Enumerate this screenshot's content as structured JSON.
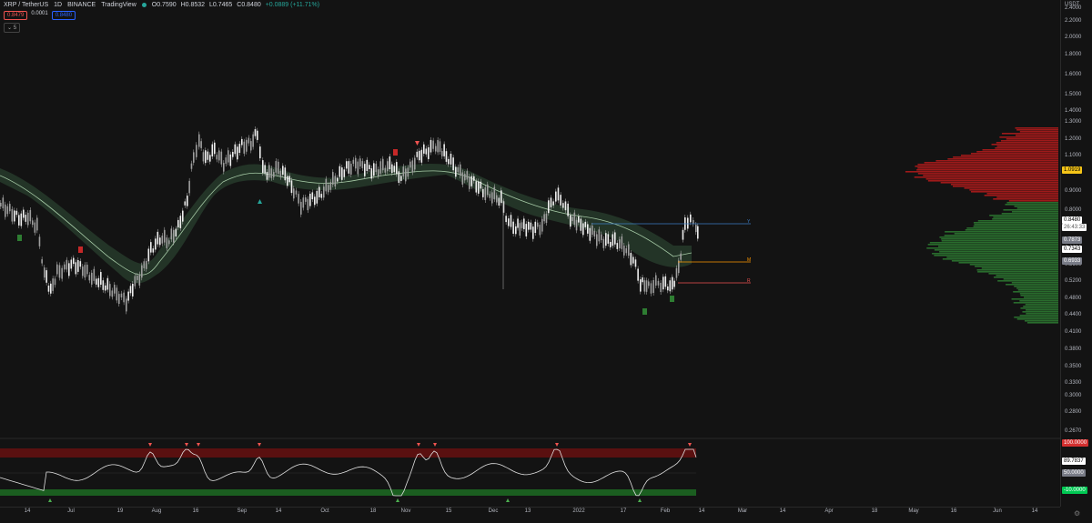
{
  "header": {
    "symbol": "XRP / TetherUS",
    "interval": "1D",
    "exchange": "BINANCE",
    "source": "TradingView",
    "ohlc": {
      "o": "O0.7590",
      "h": "H0.8532",
      "l": "L0.7465",
      "c": "C0.8480",
      "change": "+0.0889 (+11.71%)"
    }
  },
  "indicator_row": {
    "bid": "0.8479",
    "spread": "0.0001",
    "ask": "0.8480"
  },
  "collapse_label": "5",
  "price_scale": {
    "unit": "USDT",
    "ticks": [
      "2.4000",
      "2.2000",
      "2.0000",
      "1.8000",
      "1.6000",
      "1.5000",
      "1.4000",
      "1.3000",
      "1.2000",
      "1.1000",
      "1.0000",
      "0.9000",
      "0.8000",
      "0.7000",
      "0.6000",
      "0.5600",
      "0.5200",
      "0.4800",
      "0.4400",
      "0.4100",
      "0.3800",
      "0.3500",
      "0.3300",
      "0.3000",
      "0.2800",
      "0.2670"
    ],
    "tags": [
      {
        "label": "1.0919",
        "bg": "#f5c518",
        "fg": "#000000"
      },
      {
        "label": "0.8480",
        "bg": "#ffffff",
        "fg": "#000000"
      },
      {
        "label": "26:43:33",
        "bg": "#ffffff",
        "fg": "#555555"
      },
      {
        "label": "0.7873",
        "bg": "#787b86",
        "fg": "#ffffff"
      },
      {
        "label": "0.7343",
        "bg": "#ffffff",
        "fg": "#000000"
      },
      {
        "label": "0.6933",
        "bg": "#787b86",
        "fg": "#ffffff"
      }
    ]
  },
  "osc_scale": {
    "tags": [
      {
        "label": "100.0000",
        "bg": "#d32f2f",
        "fg": "#ffffff"
      },
      {
        "label": "89.7837",
        "bg": "#ffffff",
        "fg": "#000000"
      },
      {
        "label": "50.0000",
        "bg": "#787b86",
        "fg": "#ffffff"
      },
      {
        "label": "-10.0000",
        "bg": "#00c853",
        "fg": "#ffffff"
      }
    ]
  },
  "time_axis": [
    "14",
    "Jul",
    "19",
    "Aug",
    "16",
    "Sep",
    "14",
    "Oct",
    "18",
    "Nov",
    "15",
    "Dec",
    "13",
    "2022",
    "17",
    "Feb",
    "14",
    "Mar",
    "14",
    "Apr",
    "18",
    "May",
    "16",
    "Jun",
    "14"
  ],
  "level_markers": [
    "Y",
    "M",
    "R"
  ],
  "signal_labels": [
    "S",
    "S",
    "S",
    "R",
    "B",
    "B"
  ],
  "colors": {
    "bull": "#e0e0e0",
    "bear": "#e0e0e0",
    "ribbon": "#2e4a2e",
    "vp_red": "#b71c1c",
    "vp_green": "#2e7d32",
    "osc_line": "#e0e0e0"
  }
}
